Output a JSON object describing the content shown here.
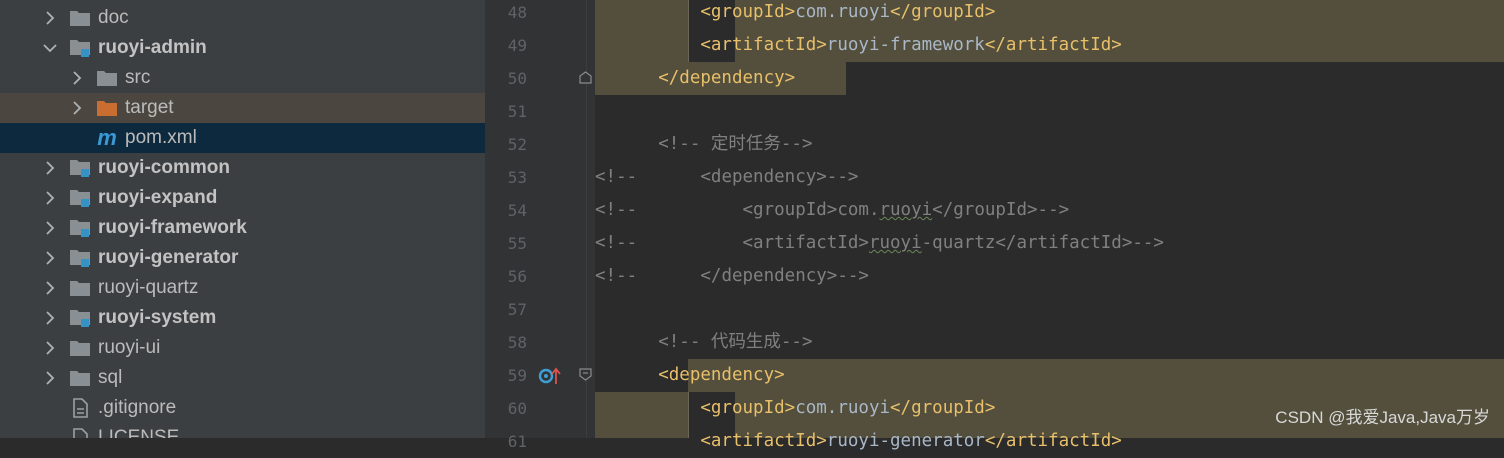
{
  "tree": {
    "items": [
      {
        "label": "doc",
        "icon": "folder-icon",
        "bold": false
      },
      {
        "label": "ruoyi-admin",
        "icon": "module-folder-icon",
        "bold": true
      },
      {
        "label": "src",
        "icon": "folder-icon",
        "bold": false
      },
      {
        "label": "target",
        "icon": "excluded-folder-icon",
        "bold": false
      },
      {
        "label": "pom.xml",
        "icon": "maven-icon",
        "bold": false,
        "icon_glyph": "m"
      },
      {
        "label": "ruoyi-common",
        "icon": "module-folder-icon",
        "bold": true
      },
      {
        "label": "ruoyi-expand",
        "icon": "module-folder-icon",
        "bold": true
      },
      {
        "label": "ruoyi-framework",
        "icon": "module-folder-icon",
        "bold": true
      },
      {
        "label": "ruoyi-generator",
        "icon": "module-folder-icon",
        "bold": true
      },
      {
        "label": "ruoyi-quartz",
        "icon": "folder-icon",
        "bold": false
      },
      {
        "label": "ruoyi-system",
        "icon": "module-folder-icon",
        "bold": true
      },
      {
        "label": "ruoyi-ui",
        "icon": "folder-icon",
        "bold": false
      },
      {
        "label": "sql",
        "icon": "folder-icon",
        "bold": false
      },
      {
        "label": ".gitignore",
        "icon": "file-icon",
        "bold": false
      },
      {
        "label": "LICENSE",
        "icon": "file-icon",
        "bold": false
      }
    ]
  },
  "editor": {
    "line_numbers": [
      "48",
      "49",
      "50",
      "51",
      "52",
      "53",
      "54",
      "55",
      "56",
      "57",
      "58",
      "59",
      "60",
      "61"
    ],
    "lines": {
      "l48_open": "<groupId>",
      "l48_text": "com.ruoyi",
      "l48_close": "</groupId>",
      "l49_open": "<artifactId>",
      "l49_text": "ruoyi-framework",
      "l49_close": "</artifactId>",
      "l50": "</dependency>",
      "l52": "<!-- 定时任务-->",
      "l53_cm": "<!--",
      "l53": "<dependency>-->",
      "l54_cm": "<!--",
      "l54_a": "<groupId>com.",
      "l54_b": "ruoyi",
      "l54_c": "</groupId>-->",
      "l55_cm": "<!--",
      "l55_a": "<artifactId>",
      "l55_b": "ruoyi",
      "l55_c": "-quartz</artifactId>-->",
      "l56_cm": "<!--",
      "l56": "</dependency>-->",
      "l58": "<!-- 代码生成-->",
      "l59": "<dependency>",
      "l60_open": "<groupId>",
      "l60_text": "com.ruoyi",
      "l60_close": "</groupId>",
      "l61_open": "<artifactId>",
      "l61_text": "ruoyi-generator",
      "l61_close": "</artifactId>"
    }
  },
  "watermark": "CSDN @我爱Java,Java万岁",
  "colors": {
    "tree_bg": "#3c3f41",
    "selected_row": "#0d293e",
    "target_row": "#4b4740",
    "editor_bg": "#2b2b2b",
    "tag": "#e8bf6a",
    "comment": "#808080",
    "highlight": "#534f3c",
    "folder": "#8a8f94",
    "module_marker": "#3592c4",
    "excluded_folder": "#c96d31"
  }
}
